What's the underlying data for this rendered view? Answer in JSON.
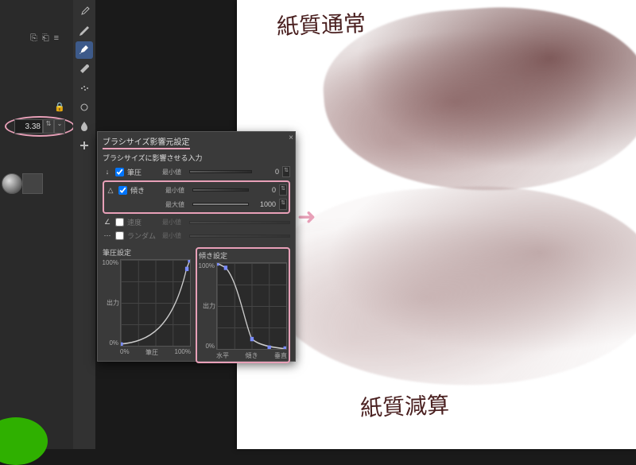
{
  "brush_size": "3.38",
  "popup": {
    "title": "ブラシサイズ影響元設定",
    "inputs_label": "ブラシサイズに影響させる入力",
    "rows": {
      "pressure": {
        "sym": "↓",
        "label": "筆圧",
        "min_label": "最小値",
        "min_val": "0"
      },
      "tilt": {
        "sym": "△",
        "label": "傾き",
        "min_label": "最小値",
        "min_val": "0",
        "max_label": "最大値",
        "max_val": "1000"
      },
      "speed": {
        "sym": "∠",
        "label": "速度",
        "min_label": "最小値"
      },
      "random": {
        "sym": "⋯",
        "label": "ランダム",
        "min_label": "最小値"
      }
    },
    "curve1": {
      "title": "筆圧設定",
      "ylabel": "出力",
      "ytop": "100%",
      "ybot": "0%",
      "x0": "0%",
      "xmid": "筆圧",
      "x1": "100%"
    },
    "curve2": {
      "title": "傾き設定",
      "ylabel": "出力",
      "ytop": "100%",
      "ybot": "0%",
      "x0": "水平",
      "xmid": "傾き",
      "x1": "垂直"
    }
  },
  "canvas": {
    "text1": "紙質通常",
    "text2": "紙質減算"
  },
  "chart_data": [
    {
      "type": "line",
      "title": "筆圧設定",
      "xlabel": "筆圧",
      "ylabel": "出力",
      "xlim": [
        0,
        100
      ],
      "ylim": [
        0,
        100
      ],
      "series": [
        {
          "name": "curve",
          "x": [
            0,
            25,
            50,
            75,
            95,
            100
          ],
          "y": [
            2,
            6,
            15,
            38,
            90,
            100
          ]
        }
      ]
    },
    {
      "type": "line",
      "title": "傾き設定",
      "xlabel": "傾き",
      "ylabel": "出力",
      "xlim": [
        0,
        100
      ],
      "ylim": [
        0,
        100
      ],
      "series": [
        {
          "name": "curve",
          "x": [
            0,
            12,
            30,
            50,
            75,
            100
          ],
          "y": [
            100,
            95,
            55,
            12,
            2,
            0
          ]
        }
      ]
    }
  ]
}
